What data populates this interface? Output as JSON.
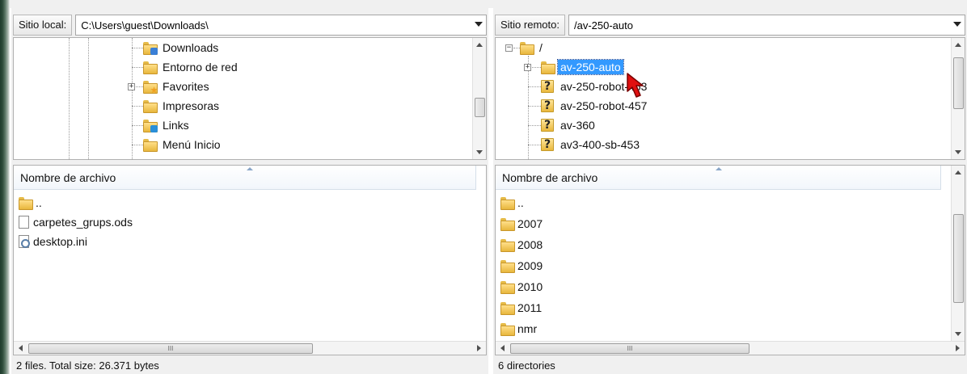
{
  "local": {
    "site_label": "Sitio local:",
    "path": "C:\\Users\\guest\\Downloads\\",
    "tree": [
      {
        "label": "Downloads",
        "icon": "downloads-folder-icon"
      },
      {
        "label": "Entorno de red",
        "icon": "folder-icon"
      },
      {
        "label": "Favorites",
        "icon": "favorites-folder-icon"
      },
      {
        "label": "Impresoras",
        "icon": "folder-icon"
      },
      {
        "label": "Links",
        "icon": "links-folder-icon"
      },
      {
        "label": "Menú Inicio",
        "icon": "folder-icon"
      }
    ],
    "list_header": "Nombre de archivo",
    "files": [
      {
        "name": "..",
        "icon": "folder-icon"
      },
      {
        "name": "carpetes_grups.ods",
        "icon": "file-icon"
      },
      {
        "name": "desktop.ini",
        "icon": "ini-file-icon"
      }
    ],
    "status": "2 files. Total size: 26.371 bytes"
  },
  "remote": {
    "site_label": "Sitio remoto:",
    "path": "/av-250-auto",
    "tree": [
      {
        "label": "/",
        "icon": "folder-icon"
      },
      {
        "label": "av-250-auto",
        "icon": "folder-icon",
        "selected": true
      },
      {
        "label": "av-250-robot-453",
        "icon": "unknown-folder-icon"
      },
      {
        "label": "av-250-robot-457",
        "icon": "unknown-folder-icon"
      },
      {
        "label": "av-360",
        "icon": "unknown-folder-icon"
      },
      {
        "label": "av3-400-sb-453",
        "icon": "unknown-folder-icon"
      }
    ],
    "list_header": "Nombre de archivo",
    "files": [
      {
        "name": "..",
        "icon": "folder-icon"
      },
      {
        "name": "2007",
        "icon": "folder-icon"
      },
      {
        "name": "2008",
        "icon": "folder-icon"
      },
      {
        "name": "2009",
        "icon": "folder-icon"
      },
      {
        "name": "2010",
        "icon": "folder-icon"
      },
      {
        "name": "2011",
        "icon": "folder-icon"
      },
      {
        "name": "nmr",
        "icon": "folder-icon"
      }
    ],
    "status": "6 directories"
  },
  "scrollbar_grip": "III",
  "colors": {
    "selection": "#3399ff",
    "cursor": "#e01010"
  }
}
